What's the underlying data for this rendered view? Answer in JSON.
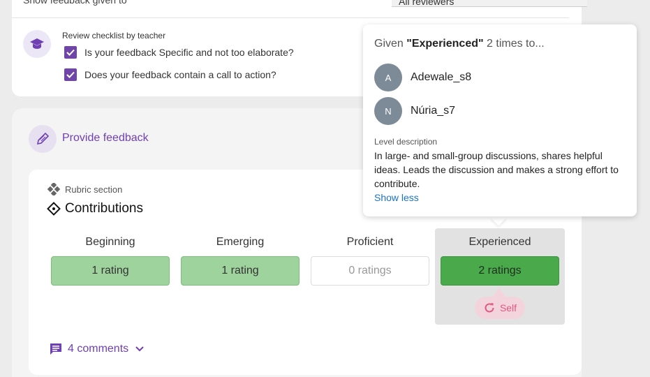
{
  "top": {
    "filter_label": "Show feedback given to",
    "filter_value": "All reviewers"
  },
  "checklist": {
    "title": "Review checklist by teacher",
    "items": [
      {
        "label": "Is your feedback Specific and not too elaborate?",
        "checked": true
      },
      {
        "label": "Does your feedback contain a call to action?",
        "checked": true
      }
    ]
  },
  "feedback": {
    "provide_label": "Provide feedback",
    "section_label": "Rubric section",
    "title": "Contributions",
    "levels": [
      {
        "name": "Beginning",
        "rating": "1 rating"
      },
      {
        "name": "Emerging",
        "rating": "1 rating"
      },
      {
        "name": "Proficient",
        "rating": "0 ratings"
      },
      {
        "name": "Experienced",
        "rating": "2 ratings"
      }
    ],
    "self_label": "Self",
    "comments_label": "4 comments"
  },
  "popup": {
    "given_prefix": "Given",
    "given_level": "\"Experienced\"",
    "given_suffix": "2 times to...",
    "people": [
      {
        "initial": "A",
        "name": "Adewale_s8"
      },
      {
        "initial": "N",
        "name": "Núria_s7"
      }
    ],
    "level_description_label": "Level description",
    "level_description": "In large- and small-group discussions, shares helpful ideas. Leads the discussion and makes a strong effort to contribute.",
    "show_less": "Show less"
  },
  "colors": {
    "accent": "#6f3fb3",
    "rating_light": "#9fd39d",
    "rating_dark": "#4aaa4b",
    "self_chip": "#f3d4dc",
    "link": "#1a73c8"
  }
}
